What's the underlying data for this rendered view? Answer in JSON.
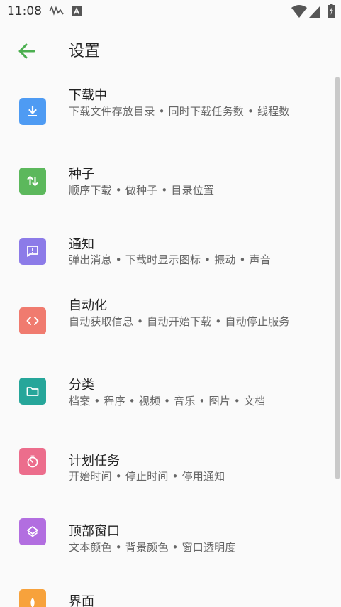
{
  "status_bar": {
    "time": "11:08",
    "icons": [
      "signal-activity-icon",
      "notification-a-icon",
      "wifi-icon",
      "cell-signal-icon",
      "battery-charging-icon"
    ]
  },
  "app_bar": {
    "title": "设置",
    "back_icon": "arrow-back-icon",
    "accent_color": "#4caf50"
  },
  "settings": {
    "items": [
      {
        "title": "下载中",
        "summary": "下载文件存放目录 • 同时下载任务数 • 线程数",
        "icon": "download-icon",
        "color": "#4e9bf3"
      },
      {
        "title": "种子",
        "summary": "顺序下载 • 做种子 • 目录位置",
        "icon": "swap-vert-icon",
        "color": "#5cb85c"
      },
      {
        "title": "通知",
        "summary": "弹出消息 • 下载时显示图标 • 振动 • 声音",
        "icon": "notification-message-icon",
        "color": "#8c7be8"
      },
      {
        "title": "自动化",
        "summary": "自动获取信息 • 自动开始下载 • 自动停止服务",
        "icon": "code-icon",
        "color": "#f07b6f"
      },
      {
        "title": "分类",
        "summary": "档案 • 程序 • 视频 • 音乐 • 图片 • 文档",
        "icon": "folder-icon",
        "color": "#26a69a"
      },
      {
        "title": "计划任务",
        "summary": "开始时间 • 停止时间 • 停用通知",
        "icon": "timer-icon",
        "color": "#ec6d8c"
      },
      {
        "title": "顶部窗口",
        "summary": "文本颜色 • 背景颜色 • 窗口透明度",
        "icon": "layers-icon",
        "color": "#b26ee0"
      },
      {
        "title": "界面",
        "summary": "",
        "icon": "brightness-icon",
        "color": "#f7a23c"
      }
    ]
  }
}
